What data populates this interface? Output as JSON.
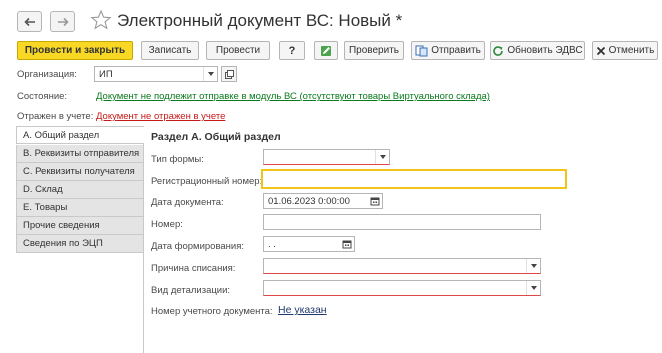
{
  "window": {
    "title": "Электронный документ ВС: Новый *"
  },
  "toolbar": {
    "post_close": "Провести и закрыть",
    "save": "Записать",
    "post": "Провести",
    "help": "?",
    "check": "Проверить",
    "send": "Отправить",
    "update_edvs": "Обновить ЭДВС",
    "cancel": "Отменить"
  },
  "header": {
    "org_label": "Организация:",
    "org_value": "ИП",
    "state_label": "Состояние:",
    "state_value": "Документ не подлежит отправке в модуль ВС (отсутствуют товары Виртуального склада)",
    "reflected_label": "Отражен в учете:",
    "reflected_value": "Документ не отражен в учете"
  },
  "sidebar": {
    "items": [
      {
        "label": "А. Общий раздел"
      },
      {
        "label": "В. Реквизиты отправителя"
      },
      {
        "label": "С. Реквизиты получателя"
      },
      {
        "label": "D. Склад"
      },
      {
        "label": "E. Товары"
      },
      {
        "label": "Прочие сведения"
      },
      {
        "label": "Сведения по ЭЦП"
      }
    ]
  },
  "section_a": {
    "title": "Раздел А. Общий раздел",
    "form_type_label": "Тип формы:",
    "form_type_value": "",
    "reg_number_label": "Регистрационный номер:",
    "reg_number_value": "",
    "doc_date_label": "Дата документа:",
    "doc_date_value": "01.06.2023  0:00:00",
    "number_label": "Номер:",
    "number_value": "",
    "form_date_label": "Дата формирования:",
    "form_date_value": " .  .",
    "writeoff_reason_label": "Причина списания:",
    "writeoff_reason_value": "",
    "detail_type_label": "Вид детализации:",
    "detail_type_value": "",
    "account_doc_label": "Номер учетного документа:",
    "account_doc_value": "Не указан"
  },
  "colors": {
    "primary_button": "#f8d825",
    "link_green": "#0a7a1e",
    "link_red": "#c81818",
    "focus_border": "#f0c419",
    "error_underline": "#e04646"
  }
}
